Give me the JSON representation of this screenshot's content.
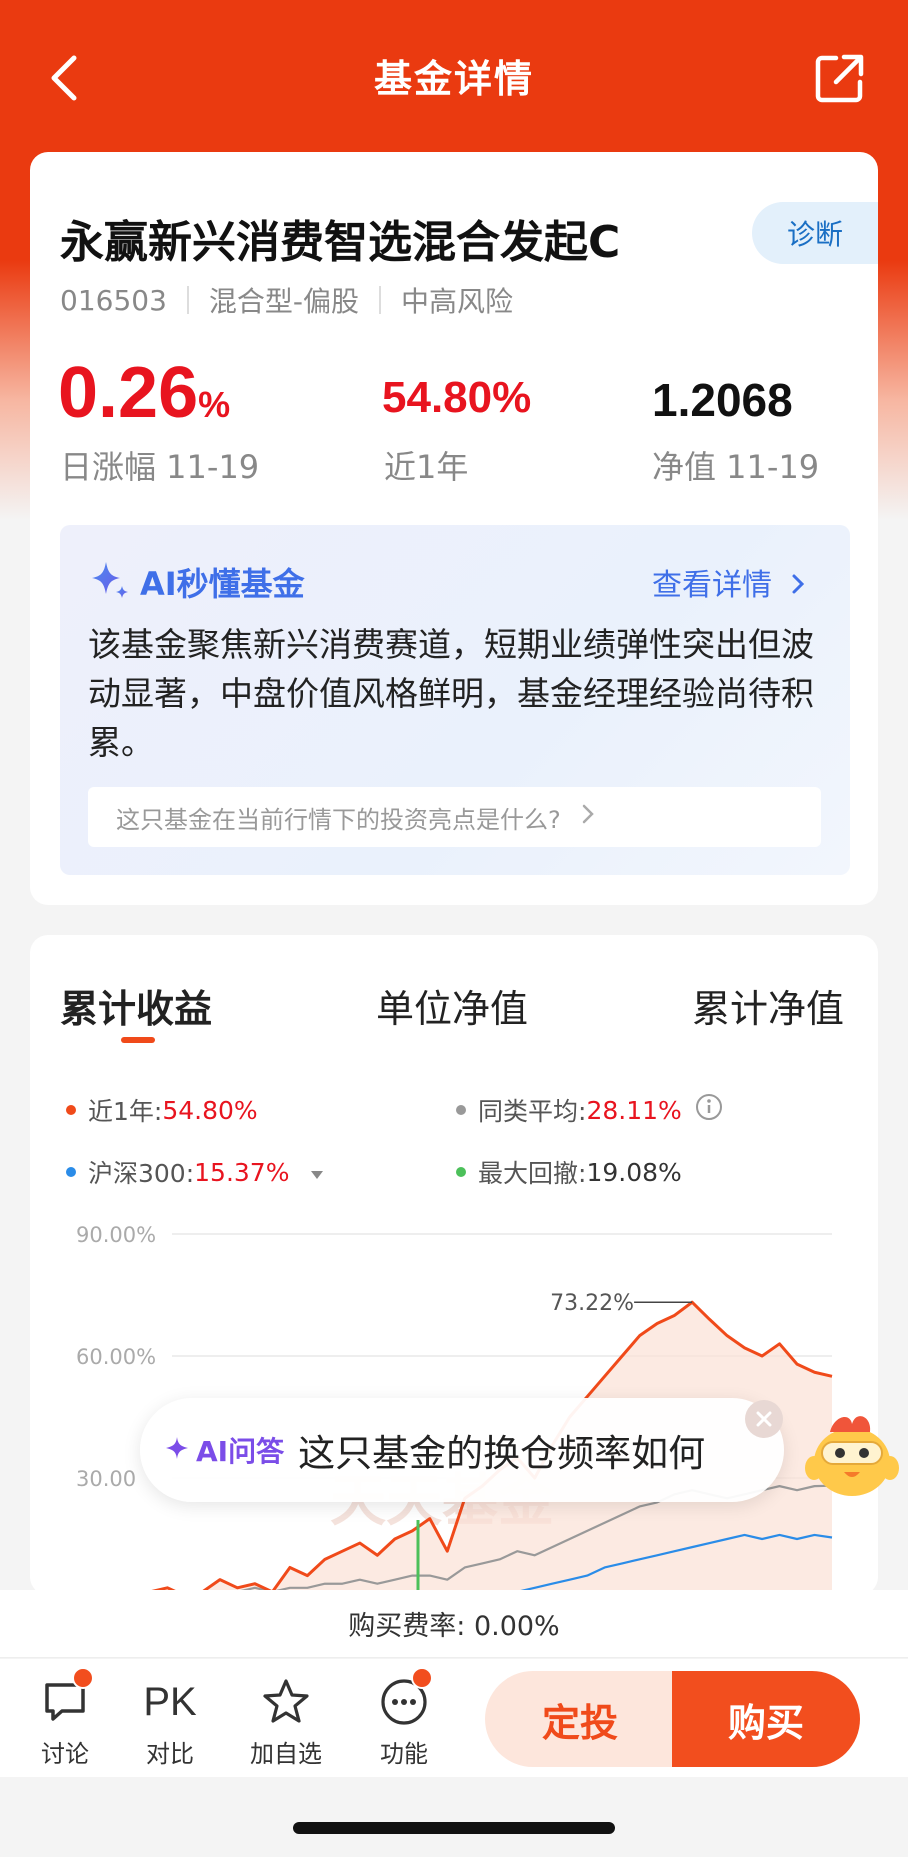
{
  "header": {
    "title": "基金详情",
    "back_icon": "chevron-left-icon",
    "share_icon": "share-icon"
  },
  "fund": {
    "name": "永赢新兴消费智选混合发起C",
    "diagnose_label": "诊断",
    "code": "016503",
    "type": "混合型-偏股",
    "risk": "中高风险",
    "daily_change": {
      "value": "0.26",
      "unit": "%",
      "label": "日涨幅 11-19"
    },
    "one_year": {
      "value": "54.80%",
      "label": "近1年"
    },
    "nav": {
      "value": "1.2068",
      "label": "净值 11-19"
    }
  },
  "ai_summary": {
    "title": "AI秒懂基金",
    "more_label": "查看详情",
    "text": "该基金聚焦新兴消费赛道，短期业绩弹性突出但波动显著，中盘价值风格鲜明，基金经理经验尚待积累。",
    "question": "这只基金在当前行情下的投资亮点是什么?"
  },
  "chart_tabs": [
    {
      "label": "累计收益",
      "active": true
    },
    {
      "label": "单位净值",
      "active": false
    },
    {
      "label": "累计净值",
      "active": false
    }
  ],
  "legend": [
    {
      "label": "近1年:",
      "value": "54.80%",
      "color": "#f04a1a"
    },
    {
      "label": "同类平均:",
      "value": "28.11%",
      "color": "#999999"
    },
    {
      "label": "沪深300:",
      "value": "15.37%",
      "color": "#2a8ce8"
    },
    {
      "label": "最大回撤:",
      "value": "19.08%",
      "color": "#4cc05a"
    }
  ],
  "chart_data": {
    "type": "line",
    "y_ticks": [
      "90.00%",
      "60.00%",
      "30.00"
    ],
    "ylim": [
      0,
      90
    ],
    "annotation": "73.22%",
    "watermark": "天天基金",
    "series": [
      {
        "name": "近1年",
        "color": "#f04a1a",
        "values": [
          2,
          3,
          1,
          2,
          5,
          3,
          4,
          2,
          8,
          6,
          10,
          12,
          14,
          11,
          15,
          17,
          20,
          12,
          25,
          28,
          32,
          35,
          30,
          38,
          45,
          50,
          55,
          60,
          65,
          68,
          70,
          73.22,
          69,
          65,
          62,
          60,
          63,
          58,
          56,
          55
        ]
      },
      {
        "name": "同类平均",
        "color": "#999999",
        "values": [
          1,
          1,
          0.5,
          1,
          2,
          2,
          3,
          2,
          3,
          3,
          4,
          4,
          5,
          4,
          5,
          6,
          6,
          5,
          8,
          9,
          10,
          12,
          11,
          13,
          15,
          17,
          19,
          21,
          23,
          24,
          26,
          27,
          26,
          25,
          26,
          27,
          28,
          27,
          28,
          28.11
        ]
      },
      {
        "name": "沪深300",
        "color": "#2a8ce8",
        "values": [
          0,
          0,
          0,
          0,
          0,
          0,
          0,
          0,
          0,
          0,
          0,
          0,
          0,
          0,
          0,
          0,
          0,
          0,
          0,
          0,
          1,
          2,
          3,
          4,
          5,
          6,
          8,
          9,
          10,
          11,
          12,
          13,
          14,
          15,
          16,
          15,
          16,
          15,
          16,
          15.37
        ]
      }
    ]
  },
  "ai_float": {
    "tag": "AI问答",
    "text": "这只基金的换仓频率如何"
  },
  "fee": {
    "text": "购买费率: 0.00%"
  },
  "bottom_nav": [
    {
      "label": "讨论",
      "icon": "chat-icon",
      "badge": true
    },
    {
      "label": "对比",
      "icon": "PK",
      "badge": false
    },
    {
      "label": "加自选",
      "icon": "star-icon",
      "badge": false
    },
    {
      "label": "功能",
      "icon": "more-icon",
      "badge": true
    }
  ],
  "actions": {
    "dingtou": "定投",
    "buy": "购买"
  }
}
